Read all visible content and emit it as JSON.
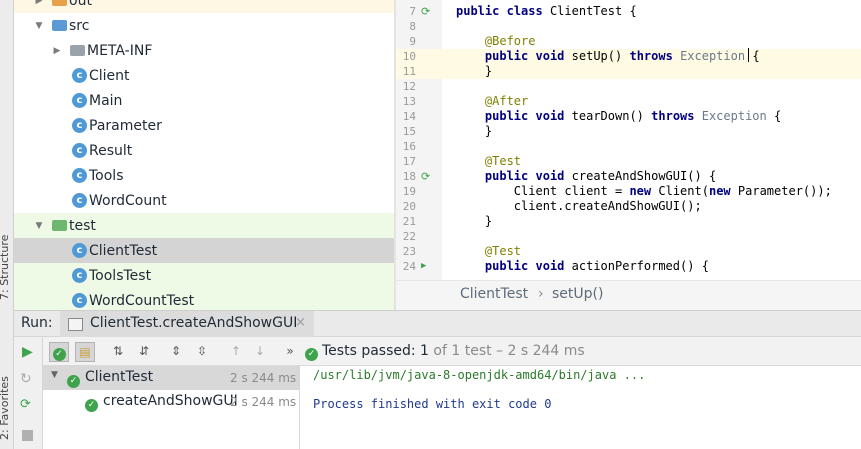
{
  "left_strip": {
    "structure_label": "7: Structure",
    "favorites_label": "2: Favorites"
  },
  "project_tree": {
    "items": [
      {
        "label": "out",
        "kind": "folder-orange",
        "arrow": "▶"
      },
      {
        "label": "src",
        "kind": "folder-blue",
        "arrow": "▼"
      },
      {
        "label": "META-INF",
        "kind": "folder-gray",
        "arrow": "▶"
      },
      {
        "label": "Client",
        "kind": "class"
      },
      {
        "label": "Main",
        "kind": "class-run"
      },
      {
        "label": "Parameter",
        "kind": "class"
      },
      {
        "label": "Result",
        "kind": "class"
      },
      {
        "label": "Tools",
        "kind": "class"
      },
      {
        "label": "WordCount",
        "kind": "class"
      },
      {
        "label": "test",
        "kind": "folder-green",
        "arrow": "▼"
      },
      {
        "label": "ClientTest",
        "kind": "class-test",
        "selected": true
      },
      {
        "label": "ToolsTest",
        "kind": "class-test"
      },
      {
        "label": "WordCountTest",
        "kind": "class-test"
      }
    ]
  },
  "editor": {
    "lines": [
      {
        "n": "7",
        "text": "public class ClientTest {"
      },
      {
        "n": "8",
        "text": ""
      },
      {
        "n": "9",
        "text": "    @Before"
      },
      {
        "n": "10",
        "text": "    public void setUp() throws Exception {"
      },
      {
        "n": "11",
        "text": "    }"
      },
      {
        "n": "12",
        "text": ""
      },
      {
        "n": "13",
        "text": "    @After"
      },
      {
        "n": "14",
        "text": "    public void tearDown() throws Exception {"
      },
      {
        "n": "15",
        "text": "    }"
      },
      {
        "n": "16",
        "text": ""
      },
      {
        "n": "17",
        "text": "    @Test"
      },
      {
        "n": "18",
        "text": "    public void createAndShowGUI() {"
      },
      {
        "n": "19",
        "text": "        Client client = new Client(new Parameter());"
      },
      {
        "n": "20",
        "text": "        client.createAndShowGUI();"
      },
      {
        "n": "21",
        "text": "    }"
      },
      {
        "n": "22",
        "text": ""
      },
      {
        "n": "23",
        "text": "    @Test"
      },
      {
        "n": "24",
        "text": "    public void actionPerformed() {"
      }
    ],
    "breadcrumb": {
      "class": "ClientTest",
      "separator": "›",
      "method": "setUp()"
    }
  },
  "run_panel": {
    "run_label": "Run:",
    "tab_label": "ClientTest.createAndShowGUI",
    "tab_close": "×",
    "status": {
      "prefix": "Tests passed:",
      "passed": "1",
      "rest": "of 1 test – 2 s 244 ms"
    },
    "test_tree": [
      {
        "label": "ClientTest",
        "time": "2 s 244 ms"
      },
      {
        "label": "createAndShowGUI",
        "time": "2 s 244 ms"
      }
    ],
    "console": {
      "command": "/usr/lib/jvm/java-8-openjdk-amd64/bin/java ...",
      "exit": "Process finished with exit code 0"
    }
  },
  "colors": {
    "accent_green": "#3fa34d",
    "class_blue": "#4f9ad6",
    "keyword": "#000080",
    "annotation": "#808000",
    "test_bg": "#eef9e6",
    "selected_bg": "#d4d4d4"
  }
}
